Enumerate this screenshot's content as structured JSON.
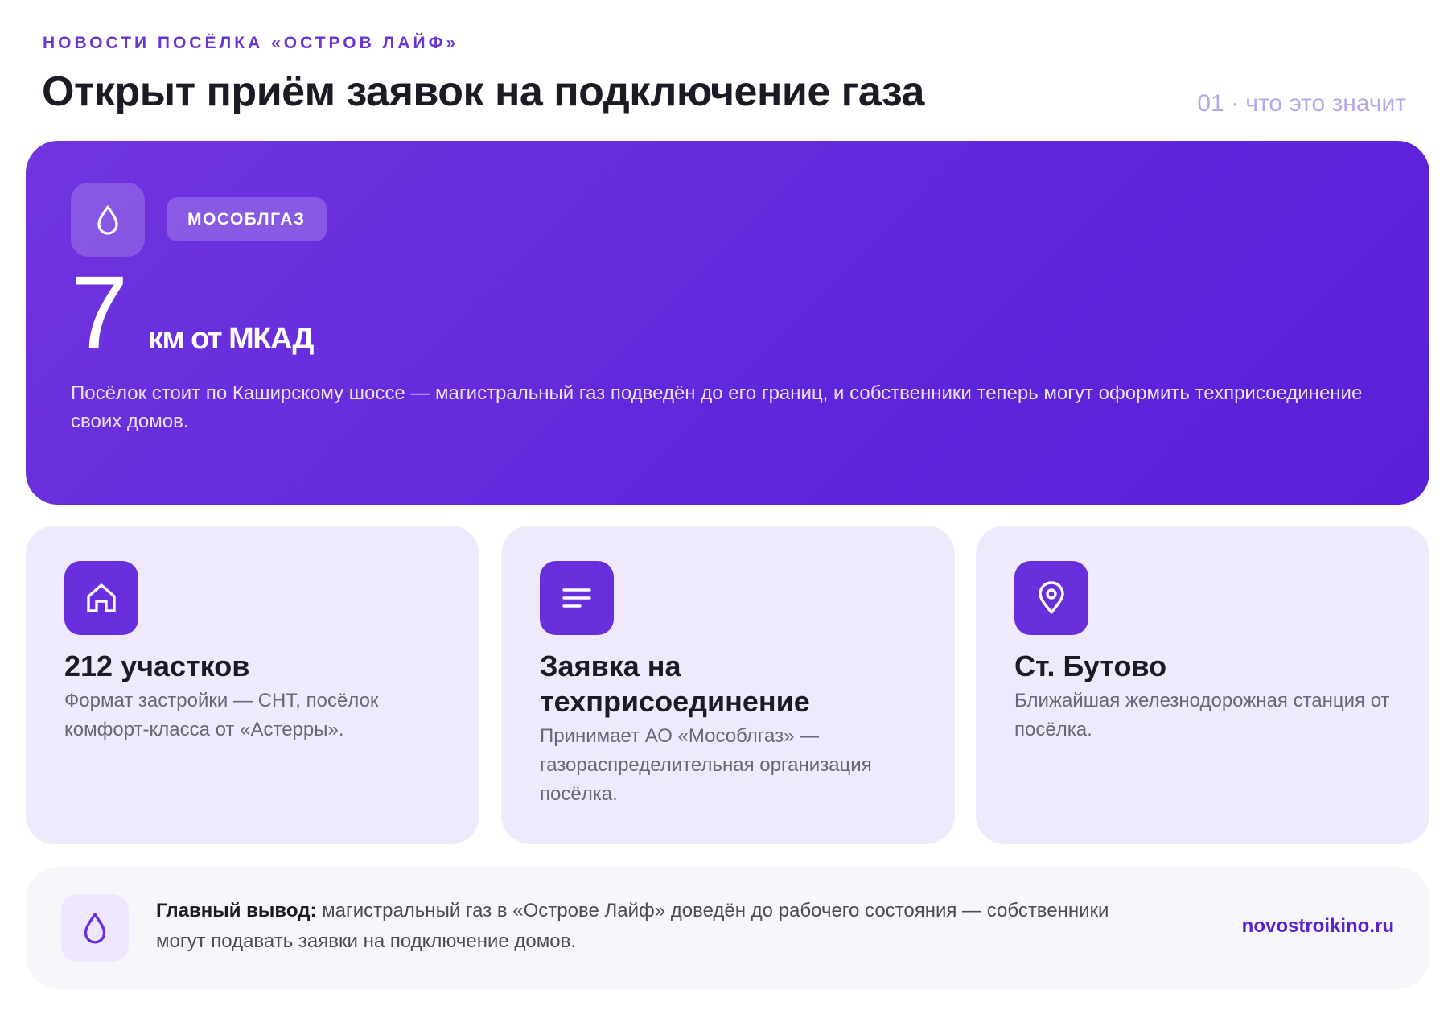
{
  "header": {
    "eyebrow": "НОВОСТИ ПОСЁЛКА «ОСТРОВ ЛАЙФ»",
    "title": "Открыт приём заявок на подключение газа",
    "counter": "01 · что это значит"
  },
  "hero": {
    "icon": "drop-icon",
    "badge": "МОСОБЛГАЗ",
    "number": "7",
    "unit": "км от МКАД",
    "description": "Посёлок стоит по Каширскому шоссе — магистральный газ подведён до его границ, и собственники теперь могут оформить техприсоединение своих домов.",
    "colors": {
      "gradient_start": "#7035de",
      "gradient_end": "#5a1fd8"
    }
  },
  "cards": [
    {
      "icon": "house-icon",
      "title": "212 участков",
      "description": "Формат застройки — СНТ, посёлок комфорт-класса от «Астерры»."
    },
    {
      "icon": "lines-icon",
      "title": "Заявка на техприсоединение",
      "description": "Принимает АО «Мособлгаз» — газораспределительная организация посёлка."
    },
    {
      "icon": "map-pin-icon",
      "title": "Ст. Бутово",
      "description": "Ближайшая железнодорожная станция от посёлка."
    }
  ],
  "footer": {
    "icon": "drop-icon",
    "label": "Главный вывод:",
    "text": " магистральный газ в «Острове Лайф» доведён до рабочего состояния — собственники могут подавать заявки на подключение домов.",
    "link": "novostroikino.ru"
  },
  "colors": {
    "accent": "#6a2fdc",
    "card_bg": "#efe9fd",
    "footer_bg": "#f7f6fb",
    "link": "#5b1fd3"
  }
}
